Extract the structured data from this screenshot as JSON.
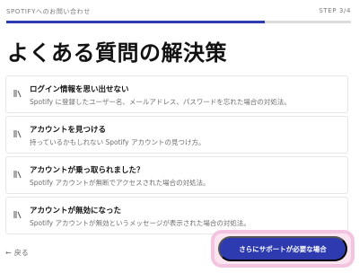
{
  "header": {
    "breadcrumb": "SPOTIFYへのお問い合わせ",
    "step": "STEP 3/4",
    "progress_fraction": 0.75
  },
  "title": "よくある質問の解決策",
  "faq_items": [
    {
      "question": "ログイン情報を思い出せない",
      "answer": "Spotify に登録したユーザー名、メールアドレス、パスワードを忘れた場合の対処法。"
    },
    {
      "question": "アカウントを見つける",
      "answer": "持っているかもしれない Spotify アカウントの見つけ方。"
    },
    {
      "question": "アカウントが乗っ取られました？",
      "answer": "Spotify アカウントが無断でアクセスされた場合の対処法。"
    },
    {
      "question": "アカウントが無効になった",
      "answer": "Spotify アカウントが無効というメッセージが表示された場合の対処法。"
    }
  ],
  "icons": {
    "faq_item": "books-icon",
    "back": "arrow-left-icon"
  },
  "footer": {
    "back_label": "戻る",
    "cta_label": "さらにサポートが必要な場合"
  },
  "colors": {
    "accent": "#2e3bb0",
    "highlight": "#f3c4e0"
  }
}
